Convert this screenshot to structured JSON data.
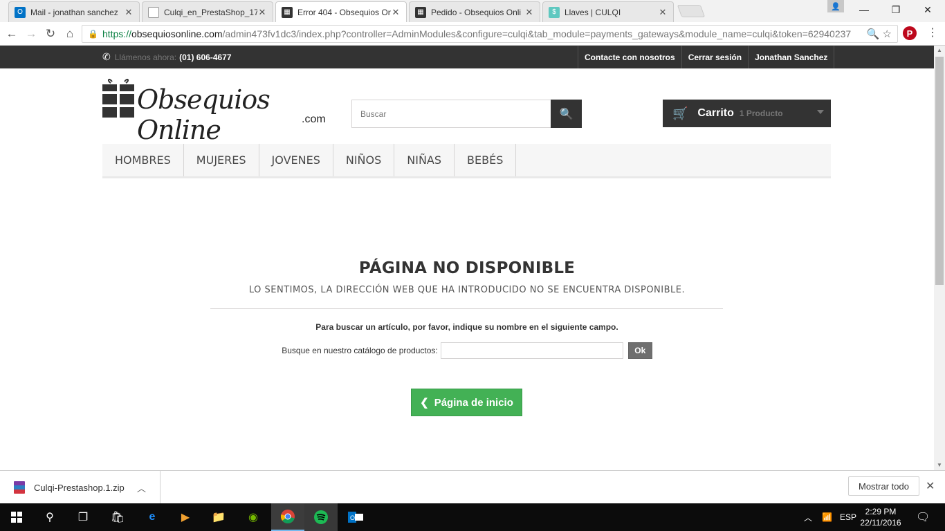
{
  "browser": {
    "tabs": [
      {
        "title": "Mail - jonathan sanchez",
        "favicon": "outlook-icon",
        "color": "#0072c6"
      },
      {
        "title": "Culqi_en_PrestaShop_17",
        "favicon": "document-icon",
        "color": "#888888"
      },
      {
        "title": "Error 404 - Obsequios On",
        "favicon": "store-icon",
        "color": "#333333"
      },
      {
        "title": "Pedido - Obsequios Onli",
        "favicon": "store-icon",
        "color": "#333333"
      },
      {
        "title": "Llaves | CULQI",
        "favicon": "culqi-icon",
        "color": "#5fc8c0"
      }
    ],
    "url": {
      "scheme": "https://",
      "host": "obsequiosonline.com",
      "path": "/admin473fv1dc3/index.php?controller=AdminModules&configure=culqi&tab_module=payments_gateways&module_name=culqi&token=62940237"
    }
  },
  "site": {
    "phone_label": "Llámenos ahora:",
    "phone_number": "(01) 606-4677",
    "top_links": [
      "Contacte con nosotros",
      "Cerrar sesión",
      "Jonathan Sanchez"
    ],
    "logo_text": "Obsequios Online",
    "logo_com": ".com",
    "search_placeholder": "Buscar",
    "cart_label": "Carrito",
    "cart_qty": "1 Producto",
    "menu": [
      "HOMBRES",
      "MUJERES",
      "JOVENES",
      "NIÑOS",
      "NIÑAS",
      "BEBÉS"
    ]
  },
  "error": {
    "title": "PÁGINA NO DISPONIBLE",
    "subtitle": "LO SENTIMOS, LA DIRECCIÓN WEB QUE HA INTRODUCIDO NO SE ENCUENTRA DISPONIBLE.",
    "hint": "Para buscar un artículo, por favor, indique su nombre en el siguiente campo.",
    "search_label": "Busque en nuestro catálogo de productos:",
    "ok_label": "Ok",
    "home_label": "Página de inicio"
  },
  "downloads": {
    "file": "Culqi-Prestashop.1.zip",
    "show_all": "Mostrar todo"
  },
  "taskbar": {
    "lang": "ESP",
    "time": "2:29 PM",
    "date": "22/11/2016"
  }
}
